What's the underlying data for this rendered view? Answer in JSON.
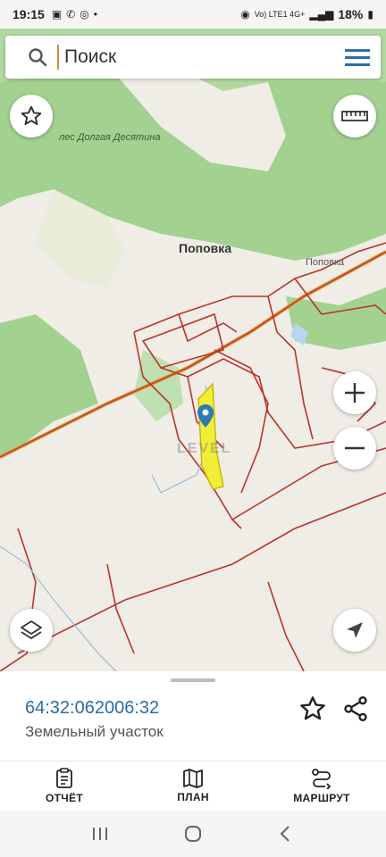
{
  "status_bar": {
    "time": "19:15",
    "right_text": "Vo) LTE1 4G+",
    "battery": "18%"
  },
  "search": {
    "placeholder": "Поиск"
  },
  "map": {
    "labels": {
      "forest": "лес Долгая Десятина",
      "village_main": "Поповка",
      "village_small": "Поповка",
      "watermark": "LEVEL"
    },
    "colors": {
      "forest": "#9fcf8c",
      "background": "#efede6",
      "boundary": "#b8342c",
      "parcel_fill": "#f1ee3a",
      "road": "#d89a3a",
      "marker": "#2d7bb5"
    }
  },
  "parcel": {
    "cadastral_number": "64:32:062006:32",
    "type": "Земельный участок"
  },
  "bottom_nav": {
    "items": [
      {
        "label": "ОТЧЁТ"
      },
      {
        "label": "ПЛАН"
      },
      {
        "label": "МАРШРУТ"
      }
    ]
  }
}
